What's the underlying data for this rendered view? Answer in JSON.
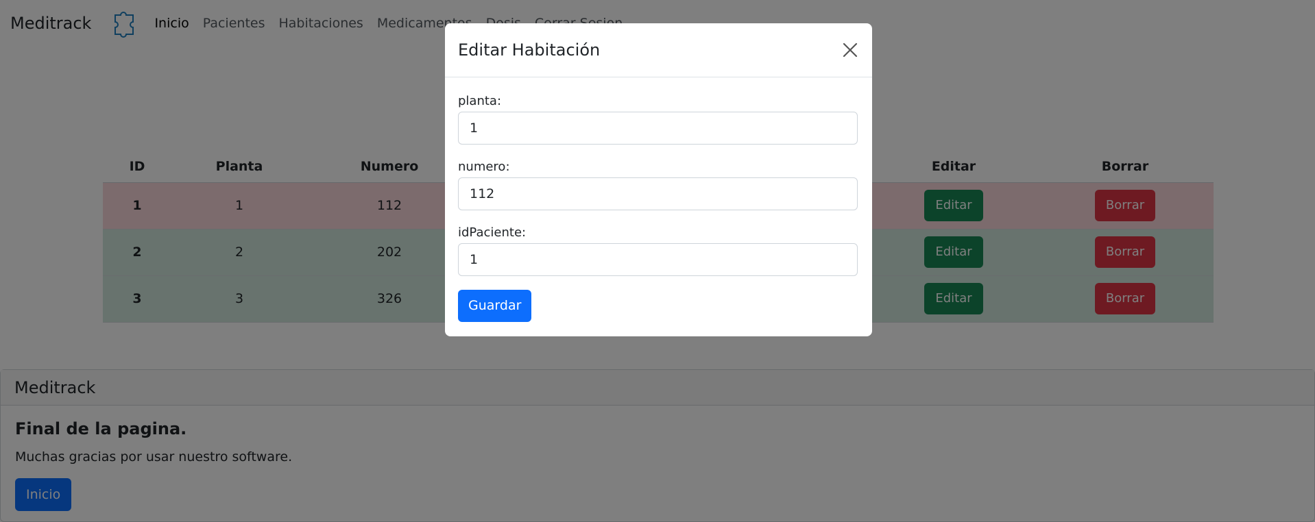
{
  "navbar": {
    "brand": "Meditrack",
    "logo_icon": "puzzle-logo-icon",
    "links": [
      {
        "label": "Inicio",
        "active": true
      },
      {
        "label": "Pacientes",
        "active": false
      },
      {
        "label": "Habitaciones",
        "active": false
      },
      {
        "label": "Medicamentos",
        "active": false
      },
      {
        "label": "Dosis",
        "active": false
      },
      {
        "label": "Cerrar Sesion",
        "active": false
      }
    ]
  },
  "table": {
    "headers": {
      "id": "ID",
      "planta": "Planta",
      "numero": "Numero",
      "editar": "Editar",
      "borrar": "Borrar"
    },
    "rows": [
      {
        "id": "1",
        "planta": "1",
        "numero": "112",
        "edit_label": "Editar",
        "delete_label": "Borrar",
        "status": "red"
      },
      {
        "id": "2",
        "planta": "2",
        "numero": "202",
        "edit_label": "Editar",
        "delete_label": "Borrar",
        "status": "green"
      },
      {
        "id": "3",
        "planta": "3",
        "numero": "326",
        "edit_label": "Editar",
        "delete_label": "Borrar",
        "status": "green"
      }
    ]
  },
  "footer": {
    "header": "Meditrack",
    "title": "Final de la pagina.",
    "text": "Muchas gracias por usar nuestro software.",
    "button": "Inicio"
  },
  "modal": {
    "title": "Editar Habitación",
    "close_icon": "close-icon",
    "fields": [
      {
        "label": "planta:",
        "value": "1"
      },
      {
        "label": "numero:",
        "value": "112"
      },
      {
        "label": "idPaciente:",
        "value": "1"
      }
    ],
    "save_label": "Guardar"
  },
  "colors": {
    "primary": "#0d6efd",
    "success": "#198754",
    "danger": "#dc3545",
    "row_red": "#f8d7da",
    "row_green": "#d1e7dd",
    "backdrop": "rgba(0,0,0,0.5)"
  }
}
